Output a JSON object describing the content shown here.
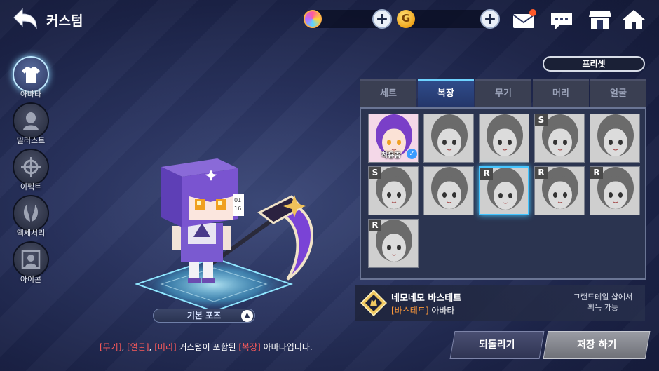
{
  "header": {
    "title": "커스텀",
    "currency_gold_symbol": "G"
  },
  "left_nav": [
    {
      "label": "아바타",
      "icon": "shirt-icon",
      "active": true
    },
    {
      "label": "일러스트",
      "icon": "person-silhouette-icon",
      "active": false
    },
    {
      "label": "이펙트",
      "icon": "effect-crosshair-icon",
      "active": false
    },
    {
      "label": "액세서리",
      "icon": "wings-icon",
      "active": false
    },
    {
      "label": "아이콘",
      "icon": "portrait-icon",
      "active": false
    }
  ],
  "character": {
    "pose_label": "기본 포즈",
    "notice_parts": [
      "[무기]",
      ", ",
      "[얼굴]",
      ", ",
      "[머리]",
      " 커스텀이 포함된 ",
      "[복장]",
      " 아바타입니다."
    ]
  },
  "preset_label": "프리셋",
  "tabs": [
    {
      "label": "세트",
      "active": false
    },
    {
      "label": "복장",
      "active": true
    },
    {
      "label": "무기",
      "active": false
    },
    {
      "label": "머리",
      "active": false
    },
    {
      "label": "얼굴",
      "active": false
    }
  ],
  "items": [
    {
      "grade": "",
      "equipped": true,
      "equipped_label": "착용중",
      "color": true
    },
    {
      "grade": ""
    },
    {
      "grade": ""
    },
    {
      "grade": "S"
    },
    {
      "grade": ""
    },
    {
      "grade": "S"
    },
    {
      "grade": ""
    },
    {
      "grade": "R",
      "selected": true
    },
    {
      "grade": "R"
    },
    {
      "grade": "R"
    },
    {
      "grade": "R"
    }
  ],
  "selected_item": {
    "name": "네모네모 바스테트",
    "type_tag": "[바스테트]",
    "type_rest": " 아바타",
    "obtain_line1": "그랜드테일 샵에서",
    "obtain_line2": "획득 가능"
  },
  "buttons": {
    "revert": "되돌리기",
    "save": "저장 하기"
  },
  "colors": {
    "accent_blue": "#46c6ff",
    "red_text": "#ff5a5a",
    "orange_text": "#ff9a3a"
  }
}
